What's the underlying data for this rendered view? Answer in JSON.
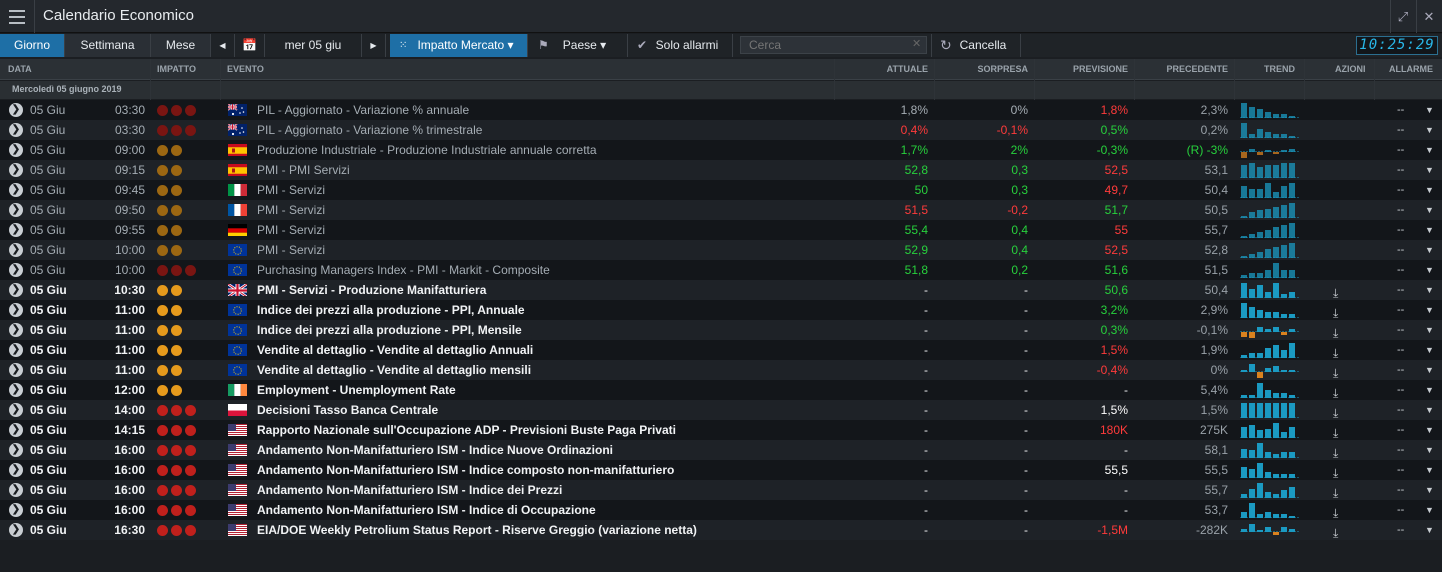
{
  "app": {
    "title": "Calendario Economico"
  },
  "toolbar": {
    "tab_day": "Giorno",
    "tab_week": "Settimana",
    "tab_month": "Mese",
    "date_label": "mer 05 giu",
    "impact_label": "Impatto Mercato ▾",
    "country_label": "Paese ▾",
    "alarms_label": "Solo allarmi",
    "search_placeholder": "Cerca",
    "cancel_label": "Cancella",
    "clock": "10:25:29"
  },
  "columns": {
    "date": "DATA",
    "impact": "IMPATTO",
    "event": "EVENTO",
    "actual": "ATTUALE",
    "surprise": "SORPRESA",
    "forecast": "PREVISIONE",
    "previous": "PRECEDENTE",
    "trend": "TREND",
    "actions": "AZIONI",
    "alarm": "ALLARME"
  },
  "group_label": "Mercoledì 05 giugno 2019",
  "colors": {
    "impact_high": "#c0201c",
    "impact_medium": "#e69a1c",
    "impact_high_past": "#7a1512",
    "impact_medium_past": "#9c6712",
    "positive": "#27d13c",
    "negative": "#ff3b3b",
    "trend_bar": "#1b9ac2",
    "trend_neg": "#d9821f"
  },
  "rows": [
    {
      "date": "05 Giu",
      "time": "03:30",
      "impact": 3,
      "flag": "au",
      "event": "PIL - Aggiornato - Variazione % annuale",
      "actual": "1,8%",
      "actual_color": "neutral",
      "surprise": "0%",
      "surprise_color": "neutral",
      "forecast": "1,8%",
      "forecast_color": "red",
      "previous": "2,3%",
      "previous_color": "neutral",
      "past": true,
      "trend": [
        8,
        6,
        5,
        3,
        2,
        2,
        1
      ]
    },
    {
      "date": "05 Giu",
      "time": "03:30",
      "impact": 3,
      "flag": "au",
      "event": "PIL - Aggiornato - Variazione % trimestrale",
      "actual": "0,4%",
      "actual_color": "red",
      "surprise": "-0,1%",
      "surprise_color": "red",
      "forecast": "0,5%",
      "forecast_color": "green",
      "previous": "0,2%",
      "previous_color": "neutral",
      "past": true,
      "trend": [
        8,
        2,
        5,
        3,
        2,
        2,
        1
      ]
    },
    {
      "date": "05 Giu",
      "time": "09:00",
      "impact": 2,
      "flag": "es",
      "event": "Produzione Industriale - Produzione Industriale annuale corretta",
      "actual": "1,7%",
      "actual_color": "green",
      "surprise": "2%",
      "surprise_color": "green",
      "forecast": "-0,3%",
      "forecast_color": "green",
      "previous": "(R) -3%",
      "previous_color": "green",
      "past": true,
      "trend": [
        -5,
        2,
        -2,
        1,
        -1,
        1,
        2
      ]
    },
    {
      "date": "05 Giu",
      "time": "09:15",
      "impact": 2,
      "flag": "es",
      "event": "PMI - PMI Servizi",
      "actual": "52,8",
      "actual_color": "green",
      "surprise": "0,3",
      "surprise_color": "green",
      "forecast": "52,5",
      "forecast_color": "red",
      "previous": "53,1",
      "previous_color": "neutral",
      "past": true,
      "trend": [
        6,
        7,
        5,
        6,
        6,
        7,
        7
      ]
    },
    {
      "date": "05 Giu",
      "time": "09:45",
      "impact": 2,
      "flag": "it",
      "event": "PMI - Servizi",
      "actual": "50",
      "actual_color": "green",
      "surprise": "0,3",
      "surprise_color": "green",
      "forecast": "49,7",
      "forecast_color": "red",
      "previous": "50,4",
      "previous_color": "neutral",
      "past": true,
      "trend": [
        4,
        3,
        3,
        5,
        2,
        4,
        5
      ]
    },
    {
      "date": "05 Giu",
      "time": "09:50",
      "impact": 2,
      "flag": "fr",
      "event": "PMI - Servizi",
      "actual": "51,5",
      "actual_color": "red",
      "surprise": "-0,2",
      "surprise_color": "red",
      "forecast": "51,7",
      "forecast_color": "green",
      "previous": "50,5",
      "previous_color": "neutral",
      "past": true,
      "trend": [
        1,
        3,
        4,
        5,
        6,
        7,
        8
      ]
    },
    {
      "date": "05 Giu",
      "time": "09:55",
      "impact": 2,
      "flag": "de",
      "event": "PMI - Servizi",
      "actual": "55,4",
      "actual_color": "green",
      "surprise": "0,4",
      "surprise_color": "green",
      "forecast": "55",
      "forecast_color": "red",
      "previous": "55,7",
      "previous_color": "neutral",
      "past": true,
      "trend": [
        1,
        2,
        3,
        4,
        6,
        7,
        8
      ]
    },
    {
      "date": "05 Giu",
      "time": "10:00",
      "impact": 2,
      "flag": "eu",
      "event": "PMI - Servizi",
      "actual": "52,9",
      "actual_color": "green",
      "surprise": "0,4",
      "surprise_color": "green",
      "forecast": "52,5",
      "forecast_color": "red",
      "previous": "52,8",
      "previous_color": "neutral",
      "past": true,
      "trend": [
        1,
        2,
        3,
        5,
        6,
        7,
        8
      ]
    },
    {
      "date": "05 Giu",
      "time": "10:00",
      "impact": 3,
      "flag": "eu",
      "event": "Purchasing Managers Index - PMI - Markit - Composite",
      "actual": "51,8",
      "actual_color": "green",
      "surprise": "0,2",
      "surprise_color": "green",
      "forecast": "51,6",
      "forecast_color": "green",
      "previous": "51,5",
      "previous_color": "neutral",
      "past": true,
      "trend": [
        1,
        2,
        2,
        3,
        6,
        3,
        3
      ]
    },
    {
      "date": "05 Giu",
      "time": "10:30",
      "impact": 2,
      "flag": "gb",
      "event": "PMI - Servizi - Produzione Manifatturiera",
      "actual": "-",
      "actual_color": "neutral",
      "surprise": "-",
      "surprise_color": "neutral",
      "forecast": "50,6",
      "forecast_color": "green",
      "previous": "50,4",
      "previous_color": "neutral",
      "past": false,
      "trend": [
        7,
        4,
        6,
        3,
        7,
        2,
        3
      ]
    },
    {
      "date": "05 Giu",
      "time": "11:00",
      "impact": 2,
      "flag": "eu",
      "event": "Indice dei prezzi alla produzione - PPI, Annuale",
      "actual": "-",
      "actual_color": "neutral",
      "surprise": "-",
      "surprise_color": "neutral",
      "forecast": "3,2%",
      "forecast_color": "green",
      "previous": "2,9%",
      "previous_color": "neutral",
      "past": false,
      "trend": [
        8,
        6,
        4,
        3,
        3,
        2,
        2
      ]
    },
    {
      "date": "05 Giu",
      "time": "11:00",
      "impact": 2,
      "flag": "eu",
      "event": "Indice dei prezzi alla produzione - PPI, Mensile",
      "actual": "-",
      "actual_color": "neutral",
      "surprise": "-",
      "surprise_color": "neutral",
      "forecast": "0,3%",
      "forecast_color": "green",
      "previous": "-0,1%",
      "previous_color": "neutral",
      "past": false,
      "trend": [
        -2,
        -3,
        2,
        1,
        2,
        -1,
        1
      ]
    },
    {
      "date": "05 Giu",
      "time": "11:00",
      "impact": 2,
      "flag": "eu",
      "event": "Vendite al dettaglio - Vendite al dettaglio Annuali",
      "actual": "-",
      "actual_color": "neutral",
      "surprise": "-",
      "surprise_color": "neutral",
      "forecast": "1,5%",
      "forecast_color": "red",
      "previous": "1,9%",
      "previous_color": "neutral",
      "past": false,
      "trend": [
        1,
        2,
        2,
        4,
        5,
        3,
        6
      ]
    },
    {
      "date": "05 Giu",
      "time": "11:00",
      "impact": 2,
      "flag": "eu",
      "event": "Vendite al dettaglio - Vendite al dettaglio mensili",
      "actual": "-",
      "actual_color": "neutral",
      "surprise": "-",
      "surprise_color": "neutral",
      "forecast": "-0,4%",
      "forecast_color": "red",
      "previous": "0%",
      "previous_color": "neutral",
      "past": false,
      "trend": [
        1,
        4,
        -3,
        2,
        3,
        1,
        1
      ]
    },
    {
      "date": "05 Giu",
      "time": "12:00",
      "impact": 2,
      "flag": "ie",
      "event": "Employment - Unemployment Rate",
      "actual": "-",
      "actual_color": "neutral",
      "surprise": "-",
      "surprise_color": "neutral",
      "forecast": "-",
      "forecast_color": "neutral",
      "previous": "5,4%",
      "previous_color": "neutral",
      "past": false,
      "trend": [
        1,
        1,
        6,
        3,
        2,
        2,
        1
      ]
    },
    {
      "date": "05 Giu",
      "time": "14:00",
      "impact": 3,
      "flag": "pl",
      "event": "Decisioni Tasso Banca Centrale",
      "actual": "-",
      "actual_color": "neutral",
      "surprise": "-",
      "surprise_color": "neutral",
      "forecast": "1,5%",
      "forecast_color": "white",
      "previous": "1,5%",
      "previous_color": "neutral",
      "past": false,
      "trend": [
        1,
        1,
        1,
        1,
        1,
        1,
        1
      ]
    },
    {
      "date": "05 Giu",
      "time": "14:15",
      "impact": 3,
      "flag": "us",
      "event": "Rapporto Nazionale sull'Occupazione ADP - Previsioni Buste Paga Privati",
      "actual": "-",
      "actual_color": "neutral",
      "surprise": "-",
      "surprise_color": "neutral",
      "forecast": "180K",
      "forecast_color": "red",
      "previous": "275K",
      "previous_color": "neutral",
      "past": false,
      "trend": [
        6,
        7,
        4,
        5,
        8,
        3,
        6
      ]
    },
    {
      "date": "05 Giu",
      "time": "16:00",
      "impact": 3,
      "flag": "us",
      "event": "Andamento Non-Manifatturiero ISM - Indice Nuove Ordinazioni",
      "actual": "-",
      "actual_color": "neutral",
      "surprise": "-",
      "surprise_color": "neutral",
      "forecast": "-",
      "forecast_color": "neutral",
      "previous": "58,1",
      "previous_color": "neutral",
      "past": false,
      "trend": [
        5,
        4,
        8,
        3,
        2,
        3,
        3
      ]
    },
    {
      "date": "05 Giu",
      "time": "16:00",
      "impact": 3,
      "flag": "us",
      "event": "Andamento Non-Manifatturiero ISM - Indice composto non-manifatturiero",
      "actual": "-",
      "actual_color": "neutral",
      "surprise": "-",
      "surprise_color": "neutral",
      "forecast": "55,5",
      "forecast_color": "white",
      "previous": "55,5",
      "previous_color": "neutral",
      "past": false,
      "trend": [
        6,
        5,
        8,
        3,
        2,
        2,
        2
      ]
    },
    {
      "date": "05 Giu",
      "time": "16:00",
      "impact": 3,
      "flag": "us",
      "event": "Andamento Non-Manifatturiero ISM - Indice dei Prezzi",
      "actual": "-",
      "actual_color": "neutral",
      "surprise": "-",
      "surprise_color": "neutral",
      "forecast": "-",
      "forecast_color": "neutral",
      "previous": "55,7",
      "previous_color": "neutral",
      "past": false,
      "trend": [
        2,
        5,
        8,
        3,
        2,
        4,
        6
      ]
    },
    {
      "date": "05 Giu",
      "time": "16:00",
      "impact": 3,
      "flag": "us",
      "event": "Andamento Non-Manifatturiero ISM - Indice di Occupazione",
      "actual": "-",
      "actual_color": "neutral",
      "surprise": "-",
      "surprise_color": "neutral",
      "forecast": "-",
      "forecast_color": "neutral",
      "previous": "53,7",
      "previous_color": "neutral",
      "past": false,
      "trend": [
        3,
        8,
        2,
        3,
        2,
        2,
        1
      ]
    },
    {
      "date": "05 Giu",
      "time": "16:30",
      "impact": 3,
      "flag": "us",
      "event": "EIA/DOE Weekly Petrolium Status Report - Riserve Greggio (variazione netta)",
      "actual": "-",
      "actual_color": "neutral",
      "surprise": "-",
      "surprise_color": "neutral",
      "forecast": "-1,5M",
      "forecast_color": "red",
      "previous": "-282K",
      "previous_color": "neutral",
      "past": false,
      "trend": [
        2,
        5,
        1,
        3,
        -2,
        3,
        2
      ]
    }
  ],
  "alarm_value": "--",
  "icons": {
    "menu": "hamburger-icon",
    "expand": "expand-icon",
    "close": "close-icon",
    "row_arrow": "chevron-right-icon",
    "download": "download-icon",
    "calendar": "calendar-icon",
    "impact": "impact-dots-icon",
    "flag": "flag-icon",
    "check": "check-circle-icon",
    "refresh": "refresh-icon"
  }
}
